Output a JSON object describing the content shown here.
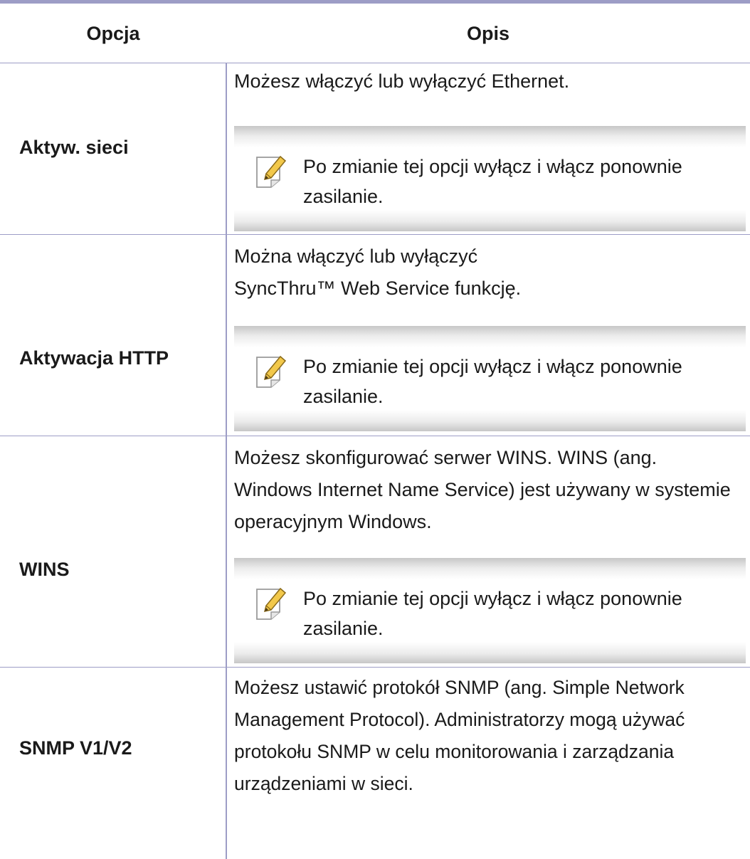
{
  "table": {
    "headers": {
      "option": "Opcja",
      "description": "Opis"
    },
    "rows": [
      {
        "option": "Aktyw. sieci",
        "description": "Możesz włączyć lub wyłączyć Ethernet.",
        "note": "Po zmianie tej opcji wyłącz i włącz ponownie zasilanie."
      },
      {
        "option": "Aktywacja HTTP",
        "description": "Można włączyć lub wyłączyć SyncThru™ Web Service funkcję.",
        "note": "Po zmianie tej opcji wyłącz i włącz ponownie zasilanie."
      },
      {
        "option": "WINS",
        "description": "Możesz skonfigurować serwer WINS. WINS (ang. Windows Internet Name Service) jest używany w systemie operacyjnym Windows.",
        "note": "Po zmianie tej opcji wyłącz i włącz ponownie zasilanie."
      },
      {
        "option": "SNMP V1/V2",
        "description": "Możesz ustawić protokół SNMP (ang. Simple Network Management Protocol). Administratorzy mogą używać protokołu SNMP w celu monitorowania i zarządzania urządzeniami w sieci."
      }
    ]
  },
  "icons": {
    "note_icon": "pencil-note-icon"
  },
  "colors": {
    "rule": "#9d9dc6",
    "pencil": "#f2c84a"
  }
}
